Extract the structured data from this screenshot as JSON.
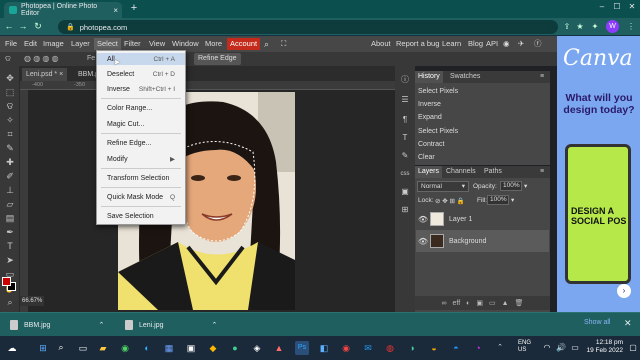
{
  "browser": {
    "tab_title": "Photopea | Online Photo Editor",
    "tab_close": "×",
    "new_tab": "+",
    "url": "photopea.com",
    "window_controls": [
      "–",
      "☐",
      "✕"
    ],
    "profile_initial": "W"
  },
  "menubar": {
    "items": [
      "File",
      "Edit",
      "Image",
      "Layer",
      "Select",
      "Filter",
      "View",
      "Window",
      "More"
    ],
    "account": "Account",
    "right_links": [
      "About",
      "Report a bug",
      "Learn",
      "Blog",
      "API"
    ]
  },
  "options_bar": {
    "feather_label": "Fe",
    "refine_edge": "Refine Edge"
  },
  "doc_tabs": [
    {
      "label": "Leni.psd *",
      "close": "×"
    },
    {
      "label": "BBM.p"
    }
  ],
  "ruler_ticks": [
    "-400",
    "-350"
  ],
  "zoom": "66.67%",
  "select_menu": {
    "items": [
      {
        "label": "All",
        "shortcut": "Ctrl + A"
      },
      {
        "label": "Deselect",
        "shortcut": "Ctrl + D"
      },
      {
        "label": "Inverse",
        "shortcut": "Shift+Ctrl + I"
      },
      {
        "label": "Color Range..."
      },
      {
        "label": "Magic Cut..."
      },
      {
        "label": "Refine Edge..."
      },
      {
        "label": "Modify",
        "arrow": "▶"
      },
      {
        "label": "Transform Selection"
      },
      {
        "label": "Quick Mask Mode",
        "shortcut": "Q"
      },
      {
        "label": "Save Selection"
      }
    ]
  },
  "history_panel": {
    "tabs": [
      "History",
      "Swatches"
    ],
    "entries": [
      "Select Pixels",
      "Inverse",
      "Expand",
      "Select Pixels",
      "Contract",
      "Clear"
    ]
  },
  "layers_panel": {
    "tabs": [
      "Layers",
      "Channels",
      "Paths"
    ],
    "blend_mode": "Normal",
    "opacity_label": "Opacity:",
    "opacity_value": "100%",
    "lock_label": "Lock:",
    "fill_label": "Fill:",
    "fill_value": "100%",
    "layers": [
      {
        "name": "Layer 1",
        "visible": true
      },
      {
        "name": "Background",
        "visible": true
      }
    ],
    "footer_icons": [
      "∞",
      "eff",
      "◐",
      "▣",
      "▭",
      "▲",
      "🗑"
    ]
  },
  "side_icons": [
    "ⓘ",
    "☰",
    "¶",
    "T",
    "css",
    "▣",
    "⊞"
  ],
  "ad": {
    "logo": "Canva",
    "headline": "What will you design today?",
    "phone_text": "DESIGN A SOCIAL POS",
    "button": "›"
  },
  "downloads": {
    "items": [
      "BBM.jpg",
      "Leni.jpg"
    ],
    "show_all": "Show all",
    "close": "✕"
  },
  "taskbar": {
    "tray_lang": "ENG",
    "tray_region": "US",
    "time": "12:18 pm",
    "date": "19 Feb 2022"
  },
  "colors": {
    "accent_account": "#c42b1c",
    "menu_highlight": "#c8d8ec",
    "ad_bg": "#7aa7f0",
    "foreground_color": "#cc0000",
    "background_color": "#000000"
  }
}
